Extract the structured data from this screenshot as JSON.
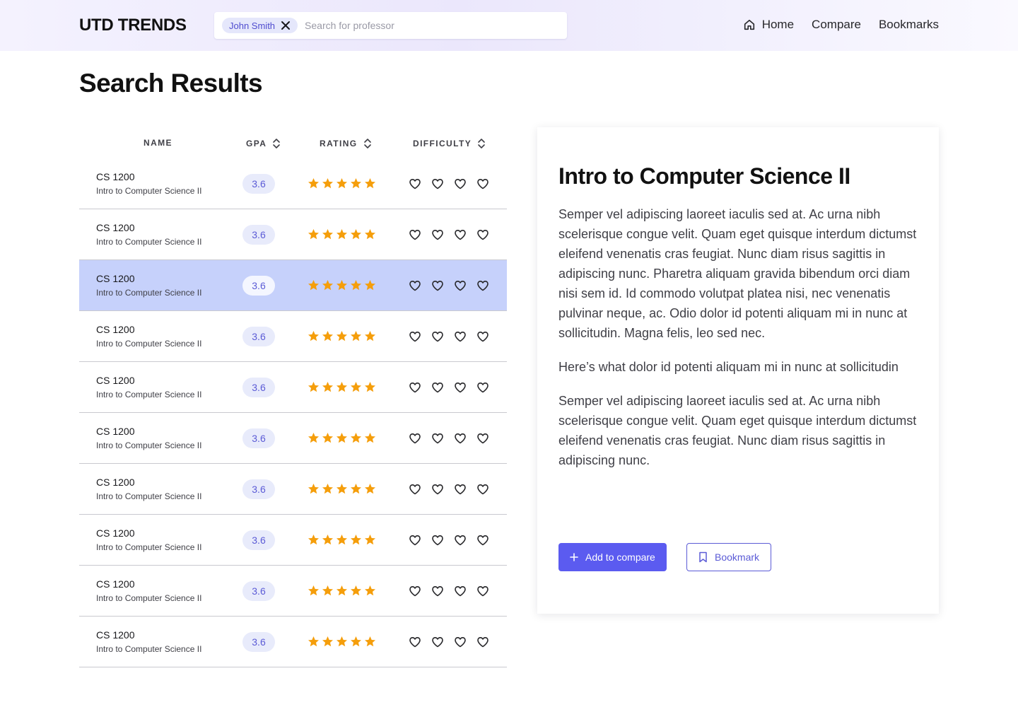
{
  "header": {
    "logo": "UTD TRENDS",
    "search": {
      "chip_label": "John Smith",
      "placeholder": "Search for professor",
      "value": ""
    },
    "nav": [
      {
        "label": "Home",
        "icon": "home-icon"
      },
      {
        "label": "Compare"
      },
      {
        "label": "Bookmarks"
      }
    ]
  },
  "page_title": "Search Results",
  "table": {
    "columns": [
      "NAME",
      "GPA",
      "RATING",
      "DIFFICULTY"
    ],
    "selected_row": 2,
    "rows": [
      {
        "code": "CS 1200",
        "name": "Intro to Computer Science II",
        "gpa": "3.6",
        "rating": 5,
        "difficulty": 4
      },
      {
        "code": "CS 1200",
        "name": "Intro to Computer Science II",
        "gpa": "3.6",
        "rating": 5,
        "difficulty": 4
      },
      {
        "code": "CS 1200",
        "name": "Intro to Computer Science II",
        "gpa": "3.6",
        "rating": 5,
        "difficulty": 4
      },
      {
        "code": "CS 1200",
        "name": "Intro to Computer Science II",
        "gpa": "3.6",
        "rating": 5,
        "difficulty": 4
      },
      {
        "code": "CS 1200",
        "name": "Intro to Computer Science II",
        "gpa": "3.6",
        "rating": 5,
        "difficulty": 4
      },
      {
        "code": "CS 1200",
        "name": "Intro to Computer Science II",
        "gpa": "3.6",
        "rating": 5,
        "difficulty": 4
      },
      {
        "code": "CS 1200",
        "name": "Intro to Computer Science II",
        "gpa": "3.6",
        "rating": 5,
        "difficulty": 4
      },
      {
        "code": "CS 1200",
        "name": "Intro to Computer Science II",
        "gpa": "3.6",
        "rating": 5,
        "difficulty": 4
      },
      {
        "code": "CS 1200",
        "name": "Intro to Computer Science II",
        "gpa": "3.6",
        "rating": 5,
        "difficulty": 4
      },
      {
        "code": "CS 1200",
        "name": "Intro to Computer Science II",
        "gpa": "3.6",
        "rating": 5,
        "difficulty": 4
      }
    ]
  },
  "detail": {
    "title": "Intro to Computer Science II",
    "paragraphs": [
      "Semper vel adipiscing laoreet iaculis sed at. Ac urna nibh scelerisque congue velit. Quam eget quisque interdum dictumst eleifend venenatis cras feugiat. Nunc diam risus sagittis in adipiscing nunc. Pharetra aliquam gravida bibendum orci diam nisi sem id. Id commodo volutpat platea nisi, nec venenatis pulvinar neque, ac. Odio dolor id potenti aliquam mi in nunc at sollicitudin. Magna felis, leo sed nec.",
      "Here’s what dolor id potenti aliquam mi in nunc at sollicitudin",
      "Semper vel adipiscing laoreet iaculis sed at. Ac urna nibh scelerisque congue velit. Quam eget quisque interdum dictumst eleifend venenatis cras feugiat. Nunc diam risus sagittis in adipiscing nunc."
    ],
    "add_compare_label": "Add to compare",
    "bookmark_label": "Bookmark"
  },
  "colors": {
    "accent": "#5b5bf0",
    "star": "#f59e0b",
    "selected_row": "#c6d1fb",
    "gpa_pill": "#e8ebfb"
  }
}
